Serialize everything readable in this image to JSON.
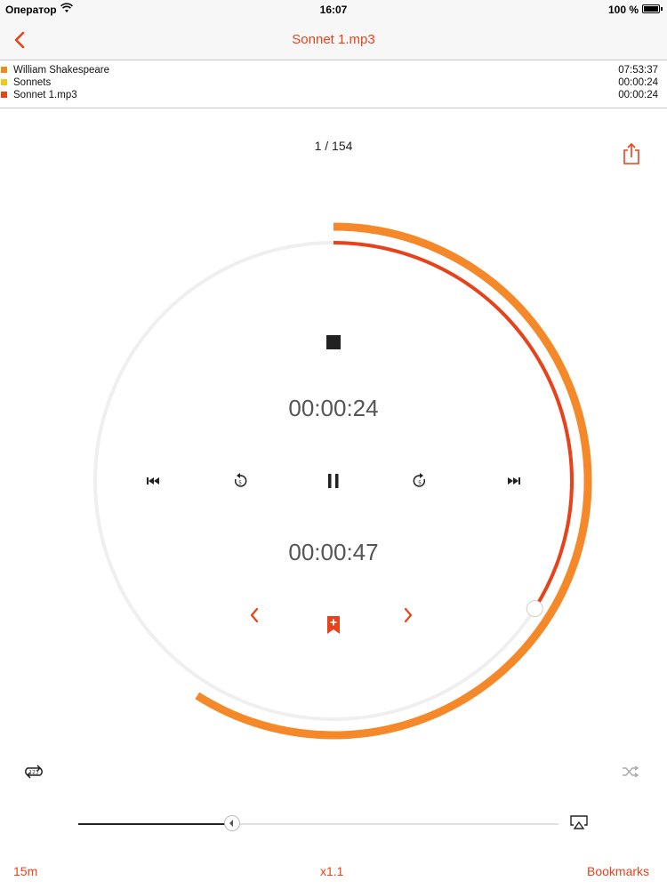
{
  "status_bar": {
    "carrier": "Оператор",
    "time": "16:07",
    "battery": "100 %"
  },
  "nav": {
    "title": "Sonnet 1.mp3",
    "back_icon": "chevron-left-icon"
  },
  "info_rows": [
    {
      "label": "William Shakespeare",
      "time": "07:53:37",
      "color": "#f18a1c"
    },
    {
      "label": "Sonnets",
      "time": "00:00:24",
      "color": "#f5c518"
    },
    {
      "label": "Sonnet 1.mp3",
      "time": "00:00:24",
      "color": "#e8421a"
    }
  ],
  "track_counter": "1 / 154",
  "player": {
    "elapsed": "00:00:24",
    "remaining": "00:00:47",
    "file_progress_fraction": 0.34,
    "total_progress_fraction": 0.59
  },
  "volume": {
    "level_fraction": 0.32
  },
  "bottom_bar": {
    "sleep_timer": "15m",
    "speed": "x1.1",
    "bookmarks": "Bookmarks"
  },
  "colors": {
    "accent": "#e8421a",
    "outer_ring": "#f5892a",
    "inner_ring": "#e8421a",
    "track": "#efefef"
  }
}
